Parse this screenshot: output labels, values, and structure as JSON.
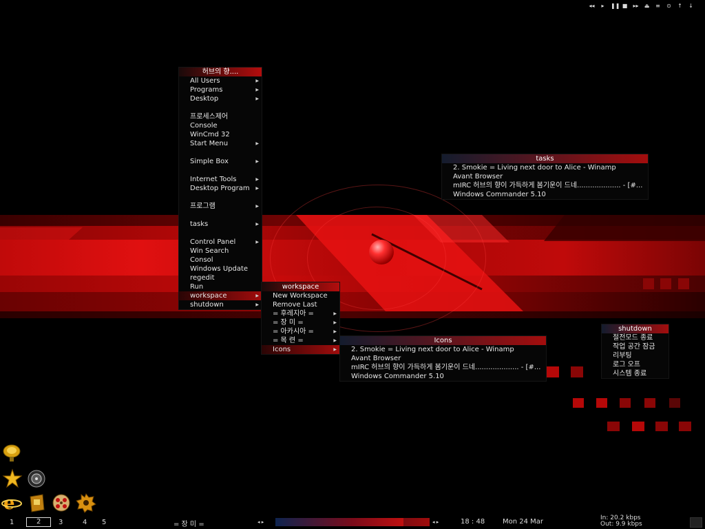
{
  "colors": {
    "accent": "#b30d0d",
    "menu_bg": "#060606",
    "title_dark": "#141c2e"
  },
  "main_menu": {
    "title": "허브의 향....",
    "items": [
      {
        "label": "All Users",
        "arrow": true
      },
      {
        "label": "Programs",
        "arrow": true
      },
      {
        "label": "Desktop",
        "arrow": true
      },
      {
        "gap": true
      },
      {
        "label": "프로세스제어",
        "arrow": false
      },
      {
        "label": "Console",
        "arrow": false
      },
      {
        "label": "WinCmd 32",
        "arrow": false
      },
      {
        "label": "Start Menu",
        "arrow": true
      },
      {
        "gap": true
      },
      {
        "label": "Simple Box",
        "arrow": true
      },
      {
        "gap": true
      },
      {
        "label": "Internet Tools",
        "arrow": true
      },
      {
        "label": "Desktop Program",
        "arrow": true
      },
      {
        "gap": true
      },
      {
        "label": "프로그램",
        "arrow": true
      },
      {
        "gap": true
      },
      {
        "label": "tasks",
        "arrow": true
      },
      {
        "gap": true
      },
      {
        "label": "Control Panel",
        "arrow": true
      },
      {
        "label": "Win Search",
        "arrow": false
      },
      {
        "label": "Consol",
        "arrow": false
      },
      {
        "label": "Windows Update",
        "arrow": false
      },
      {
        "label": "regedit",
        "arrow": false
      },
      {
        "label": "Run",
        "arrow": false
      },
      {
        "label": "workspace",
        "arrow": true,
        "selected": true
      },
      {
        "label": "shutdown",
        "arrow": true
      }
    ]
  },
  "workspace_menu": {
    "title": "workspace",
    "items": [
      {
        "label": "New Workspace",
        "arrow": false
      },
      {
        "label": "Remove Last",
        "arrow": false
      },
      {
        "label": "=  후레지아  =",
        "arrow": true
      },
      {
        "label": "=   장   미   =",
        "arrow": true
      },
      {
        "label": "=  아카시아  =",
        "arrow": true
      },
      {
        "label": "=   목   련   =",
        "arrow": true
      },
      {
        "label": "Icons",
        "arrow": true,
        "selected": true
      }
    ]
  },
  "tasks_menu": {
    "title": "tasks",
    "items": [
      {
        "label": "2. Smokie = Living next door to Alice - Winamp"
      },
      {
        "label": "Avant Browser"
      },
      {
        "label": "mIRC 허브의 향이 가득하게 봄기운이 드네.................... - [#..."
      },
      {
        "label": "Windows Commander 5.10"
      }
    ]
  },
  "icons_menu": {
    "title": "Icons",
    "items": [
      {
        "label": "2. Smokie = Living next door to Alice - Winamp"
      },
      {
        "label": "Avant Browser"
      },
      {
        "label": "mIRC 허브의 향이 가득하게 봄기운이 드네.................... - [#..."
      },
      {
        "label": "Windows Commander 5.10"
      }
    ]
  },
  "shutdown_menu": {
    "title": "shutdown",
    "items": [
      {
        "label": "절전모드 종료"
      },
      {
        "label": "작업 공간 잠금"
      },
      {
        "label": "리부팅"
      },
      {
        "label": "로그 오프"
      },
      {
        "label": "시스템 종료"
      }
    ]
  },
  "toolbar": {
    "buttons": [
      {
        "name": "prev-icon",
        "glyph": "◂◂"
      },
      {
        "name": "play-icon",
        "glyph": "▸"
      },
      {
        "name": "pause-icon",
        "glyph": "❚❚"
      },
      {
        "name": "stop-icon",
        "glyph": "■"
      },
      {
        "name": "next-icon",
        "glyph": "▸▸"
      },
      {
        "name": "eject-icon",
        "glyph": "⏏"
      },
      {
        "name": "playlist-icon",
        "glyph": "≡"
      },
      {
        "name": "options-icon",
        "glyph": "⊙"
      },
      {
        "name": "up-icon",
        "glyph": "↑"
      },
      {
        "name": "down-icon",
        "glyph": "↓"
      }
    ]
  },
  "taskbar": {
    "workspaces": [
      "1",
      "2",
      "3",
      "4",
      "5"
    ],
    "active_workspace_index": 1,
    "current_workspace": "=    장    미    =",
    "nav_left": "◂  ▸",
    "nav_right": "◂  ▸",
    "time": "18 : 48",
    "date": "Mon  24  Mar",
    "net_in": "In: 20.2 kbps",
    "net_out": "Out: 9.9 kbps",
    "progress": 0.83
  }
}
